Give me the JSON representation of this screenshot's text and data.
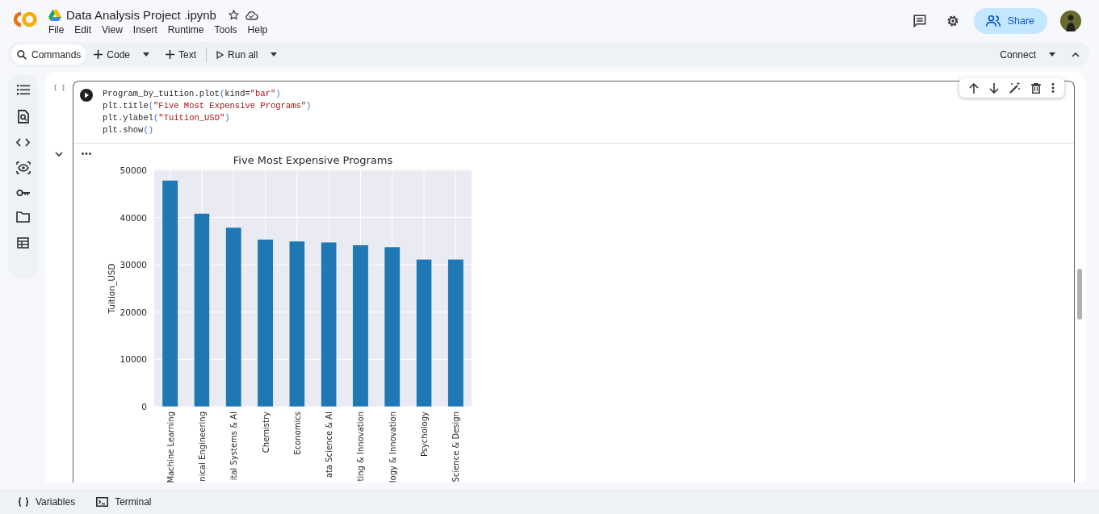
{
  "header": {
    "title": "Data Analysis Project .ipynb",
    "menu": [
      "File",
      "Edit",
      "View",
      "Insert",
      "Runtime",
      "Tools",
      "Help"
    ],
    "share": "Share"
  },
  "toolbar": {
    "commands": "Commands",
    "code": "Code",
    "text": "Text",
    "run_all": "Run all",
    "connect": "Connect"
  },
  "cell": {
    "execution_count": "[ ]",
    "expanded": true,
    "code_lines": [
      [
        {
          "text": "Program_by_tuition.plot",
          "kind": "plain"
        },
        {
          "text": "(",
          "kind": "paren"
        },
        {
          "text": "kind=",
          "kind": "plain"
        },
        {
          "text": "\"bar\"",
          "kind": "string"
        },
        {
          "text": ")",
          "kind": "paren"
        }
      ],
      [
        {
          "text": "plt.title",
          "kind": "plain"
        },
        {
          "text": "(",
          "kind": "paren"
        },
        {
          "text": "\"Five Most Expensive Programs\"",
          "kind": "string"
        },
        {
          "text": ")",
          "kind": "paren"
        }
      ],
      [
        {
          "text": "plt.ylabel",
          "kind": "plain"
        },
        {
          "text": "(",
          "kind": "paren"
        },
        {
          "text": "\"Tuition_USD\"",
          "kind": "string"
        },
        {
          "text": ")",
          "kind": "paren"
        }
      ],
      [
        {
          "text": "plt.show",
          "kind": "plain"
        },
        {
          "text": "()",
          "kind": "paren"
        }
      ]
    ],
    "chart_data": {
      "type": "bar",
      "title": "Five Most Expensive Programs",
      "ylabel": "Tuition_USD",
      "categories": [
        "Machine Learning",
        "nical Engineering",
        "ital Systems & AI",
        "Chemistry",
        "Economics",
        "ata Science & AI",
        "ting & Innovation",
        "logy & Innovation",
        "Psychology",
        "Science & Design"
      ],
      "series": [
        {
          "color": "#1f77b4",
          "values": [
            47900,
            40900,
            37900,
            35400,
            35000,
            34800,
            34200,
            33800,
            31200,
            31200
          ]
        }
      ],
      "grid": true,
      "ylim": [
        0,
        50000
      ],
      "yticks": [
        0,
        10000,
        20000,
        30000,
        40000,
        50000
      ]
    }
  },
  "bottom_bar": {
    "variables": "Variables",
    "terminal": "Terminal"
  }
}
